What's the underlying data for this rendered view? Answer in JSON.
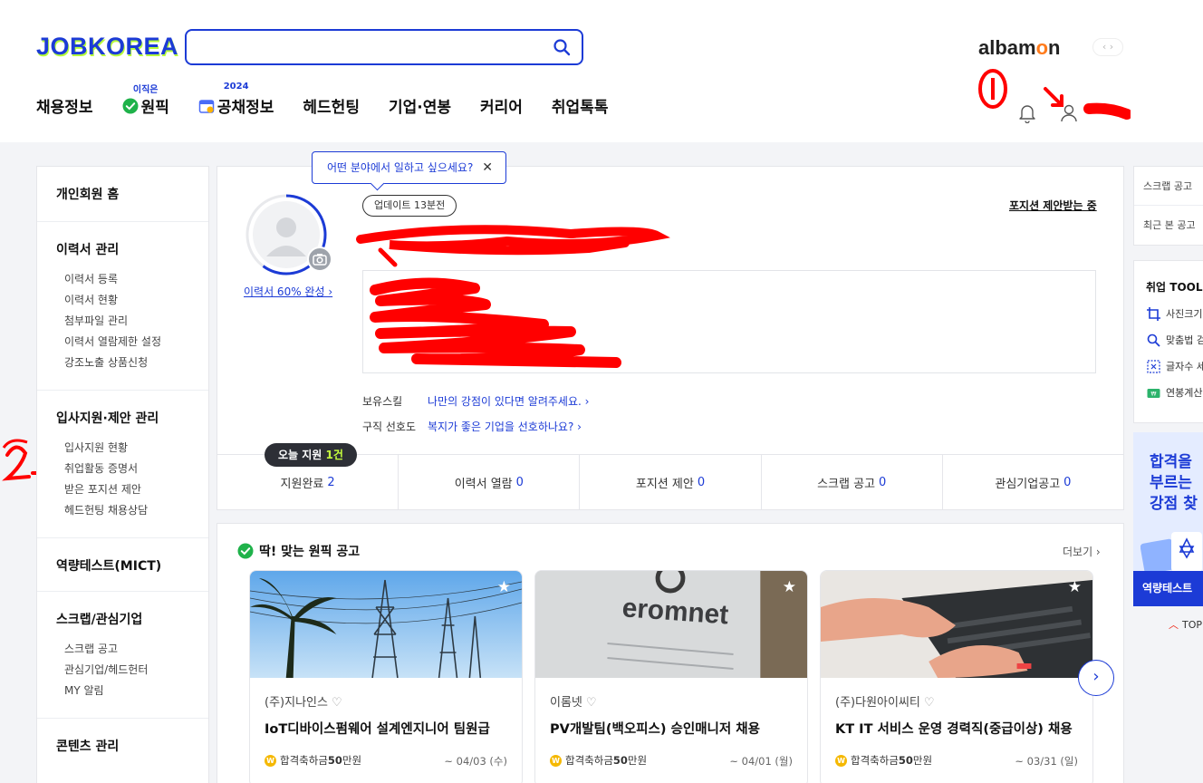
{
  "header": {
    "logo": "JOBKOREA",
    "search_placeholder": "",
    "albamon_pre": "alba",
    "albamon_o": "m",
    "albamon_post": "n",
    "albamon_arrows": "‹ ›",
    "nav": [
      {
        "label": "채용정보",
        "tag": ""
      },
      {
        "label": "원픽",
        "tag": "이직은"
      },
      {
        "label": "공채정보",
        "tag": "2024"
      },
      {
        "label": "헤드헌팅",
        "tag": ""
      },
      {
        "label": "기업·연봉",
        "tag": ""
      },
      {
        "label": "커리어",
        "tag": ""
      },
      {
        "label": "취업톡톡",
        "tag": ""
      }
    ]
  },
  "sidebar": {
    "home": "개인회원 홈",
    "resume": {
      "title": "이력서 관리",
      "links": [
        "이력서 등록",
        "이력서 현황",
        "첨부파일 관리",
        "이력서 열람제한 설정",
        "강조노출 상품신청"
      ]
    },
    "apply": {
      "title": "입사지원·제안 관리",
      "links": [
        "입사지원 현황",
        "취업활동 증명서",
        "받은 포지션 제안",
        "헤드헌팅 채용상담"
      ]
    },
    "mict": {
      "title": "역량테스트(MICT)"
    },
    "scrap": {
      "title": "스크랩/관심기업",
      "links": [
        "스크랩 공고",
        "관심기업/헤드헌터",
        "MY 알림"
      ]
    },
    "content": {
      "title": "콘텐츠 관리"
    }
  },
  "profile": {
    "tooltip": "어떤 분야에서 일하고 싶으세요?",
    "update_chip": "업데이트 13분전",
    "offer_link": "포지션 제안받는 중",
    "resume_pct": "이력서 60% 완성 ›",
    "completion_fraction": 0.6,
    "skill_label": "보유스킬",
    "skill_value": "나만의 강점이 있다면 알려주세요. ›",
    "pref_label": "구직 선호도",
    "pref_value": "복지가 좋은 기업을 선호하나요? ›",
    "today_pre": "오늘 지원 ",
    "today_n": "1건",
    "stats": [
      {
        "label": "지원완료",
        "value": "2"
      },
      {
        "label": "이력서 열람",
        "value": "0"
      },
      {
        "label": "포지션 제안",
        "value": "0"
      },
      {
        "label": "스크랩 공고",
        "value": "0"
      },
      {
        "label": "관심기업공고",
        "value": "0"
      }
    ]
  },
  "jobs": {
    "title": "딱! 맞는 원픽 공고",
    "more": "더보기 ›",
    "next": "›",
    "items": [
      {
        "company": "(주)지나인스",
        "title": "IoT디바이스펌웨어 설계엔지니어 팀원급",
        "bonus_pre": "합격축하금 ",
        "bonus_amt": "50",
        "bonus_unit": "만원",
        "date": "~ 04/03 (수)"
      },
      {
        "company": "이롬넷",
        "title": "PV개발팀(백오피스) 승인매니저 채용",
        "bonus_pre": "합격축하금 ",
        "bonus_amt": "50",
        "bonus_unit": "만원",
        "date": "~ 04/01 (월)"
      },
      {
        "company": "(주)다원아이씨티",
        "title": "KT IT 서비스 운영 경력직(중급이상) 채용",
        "bonus_pre": "합격축하금 ",
        "bonus_amt": "50",
        "bonus_unit": "만원",
        "date": "~ 03/31 (일)"
      }
    ],
    "image_text_2": "eromnet"
  },
  "right_rail": {
    "recent": [
      "스크랩 공고",
      "최근 본 공고"
    ],
    "tool_title": "취업 TOOL",
    "tools": [
      "사진크기",
      "맞춤법 검",
      "글자수 세",
      "연봉계산"
    ],
    "banner_lines": [
      "합격을",
      "부르는",
      "강점 찾"
    ],
    "banner_button": "역량테스트",
    "top": "TOP"
  },
  "annotations": {
    "mark1": "1",
    "mark2": "2"
  }
}
